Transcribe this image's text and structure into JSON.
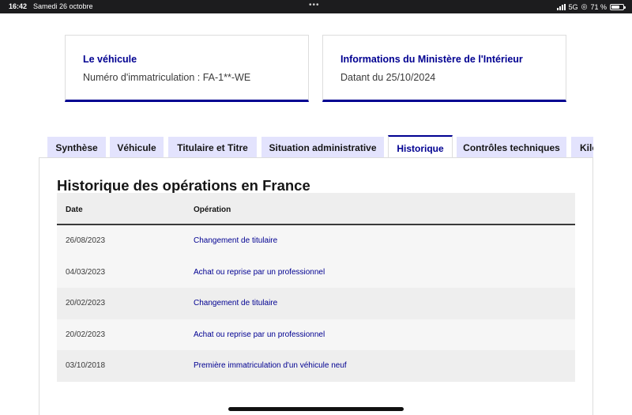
{
  "status_bar": {
    "time": "16:42",
    "date": "Samedi 26 octobre",
    "network": "5G",
    "battery": "71 %",
    "battery_level": 0.71,
    "dots": "•••"
  },
  "cards": [
    {
      "title": "Le véhicule",
      "value": "Numéro d'immatriculation : FA-1**-WE"
    },
    {
      "title": "Informations du Ministère de l'Intérieur",
      "value": "Datant du 25/10/2024"
    }
  ],
  "tabs": [
    {
      "label": "Synthèse",
      "active": false
    },
    {
      "label": "Véhicule",
      "active": false
    },
    {
      "label": "Titulaire et Titre",
      "active": false
    },
    {
      "label": "Situation administrative",
      "active": false
    },
    {
      "label": "Historique",
      "active": true
    },
    {
      "label": "Contrôles techniques",
      "active": false
    },
    {
      "label": "Kilométrage",
      "active": false
    }
  ],
  "section": {
    "title": "Historique des opérations en France"
  },
  "table": {
    "headers": {
      "date": "Date",
      "operation": "Opération"
    },
    "rows": [
      {
        "date": "26/08/2023",
        "operation": "Changement de titulaire"
      },
      {
        "date": "04/03/2023",
        "operation": "Achat ou reprise par un professionnel"
      },
      {
        "date": "20/02/2023",
        "operation": "Changement de titulaire"
      },
      {
        "date": "20/02/2023",
        "operation": "Achat ou reprise par un professionnel"
      },
      {
        "date": "03/10/2018",
        "operation": "Première immatriculation d'un véhicule neuf"
      }
    ]
  },
  "colors": {
    "accent": "#000091",
    "tab_background": "#e3e3fd",
    "header_background": "#eeeeee",
    "row_alt_background": "#f6f6f6"
  }
}
